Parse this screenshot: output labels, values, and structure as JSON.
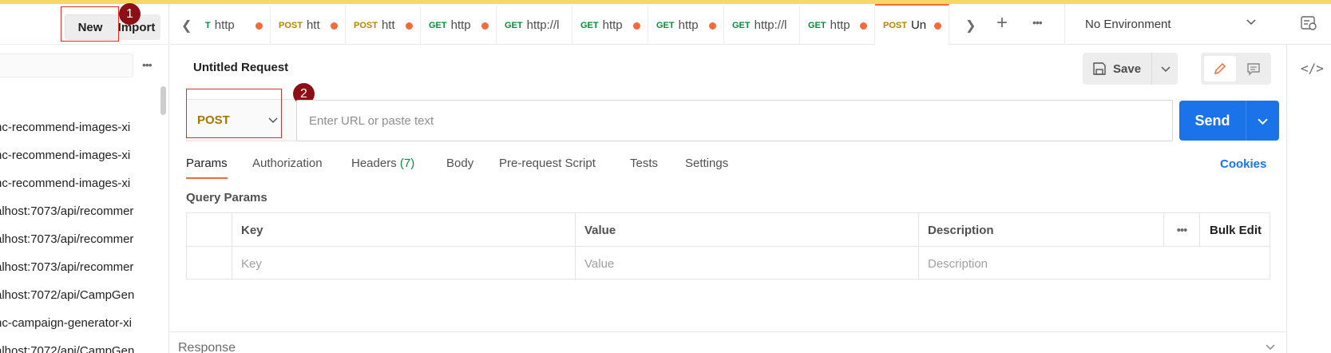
{
  "colors": {
    "accent": "#f26b3a",
    "primary": "#1a73e8",
    "get": "#0b8a3a",
    "post": "#b58300",
    "annotation": "#8b0f14",
    "strip": "#f9d765"
  },
  "sidebar": {
    "new_label": "New",
    "import_label": "Import",
    "more_icon": "more-horizontal-icon",
    "items": [
      "nc-recommend-images-xi",
      "nc-recommend-images-xi",
      "nc-recommend-images-xi",
      "alhost:7073/api/recommer",
      "alhost:7073/api/recommer",
      "alhost:7073/api/recommer",
      "alhost:7072/api/CampGen",
      "nc-campaign-generator-xi",
      "alhost:7072/api/CampGen"
    ]
  },
  "annotations": {
    "badge1": "1",
    "badge2": "2"
  },
  "tabs": [
    {
      "method": "T",
      "url": "http",
      "method_class": "get"
    },
    {
      "method": "POST",
      "url": "htt",
      "method_class": "post"
    },
    {
      "method": "POST",
      "url": "htt",
      "method_class": "post"
    },
    {
      "method": "GET",
      "url": "http",
      "method_class": "get"
    },
    {
      "method": "GET",
      "url": "http://l",
      "method_class": "get"
    },
    {
      "method": "GET",
      "url": "http",
      "method_class": "get"
    },
    {
      "method": "GET",
      "url": "http",
      "method_class": "get"
    },
    {
      "method": "GET",
      "url": "http://l",
      "method_class": "get"
    },
    {
      "method": "GET",
      "url": "http",
      "method_class": "get"
    },
    {
      "method": "POST",
      "url": "Un",
      "method_class": "post"
    }
  ],
  "environment": {
    "selected": "No Environment"
  },
  "request": {
    "title": "Untitled Request",
    "save_label": "Save",
    "method": "POST",
    "url_placeholder": "Enter URL or paste text",
    "send_label": "Send"
  },
  "request_tabs": {
    "params": "Params",
    "authorization": "Authorization",
    "headers": "Headers",
    "headers_count": "(7)",
    "body": "Body",
    "prerequest": "Pre-request Script",
    "tests": "Tests",
    "settings": "Settings",
    "cookies": "Cookies"
  },
  "query_params": {
    "label": "Query Params",
    "headers": {
      "key": "Key",
      "value": "Value",
      "description": "Description",
      "bulk_edit": "Bulk Edit"
    },
    "placeholders": {
      "key": "Key",
      "value": "Value",
      "description": "Description"
    }
  },
  "response": {
    "label": "Response"
  }
}
